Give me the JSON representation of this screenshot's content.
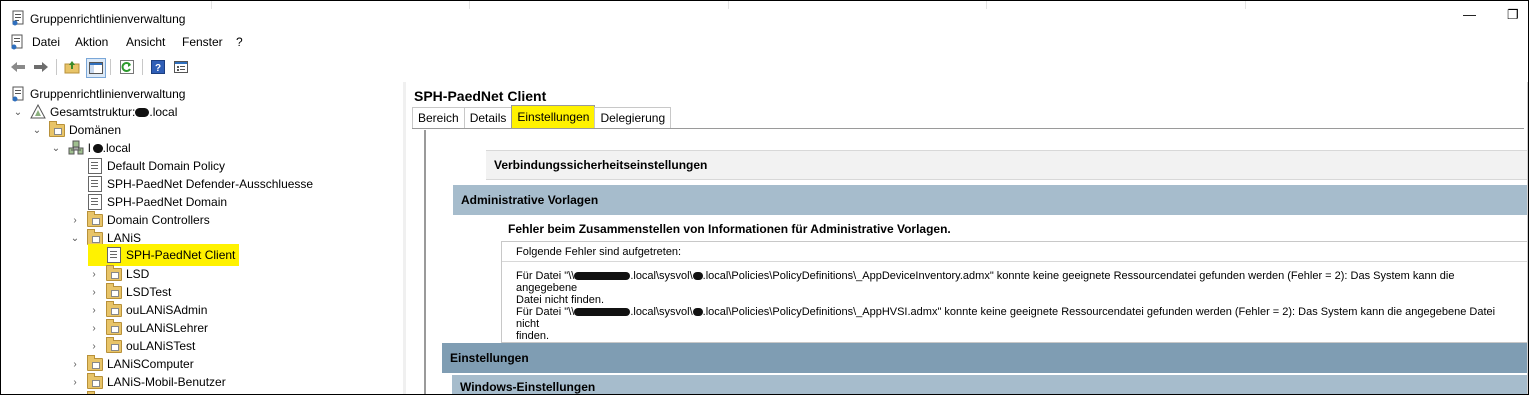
{
  "window": {
    "title": "Gruppenrichtlinienverwaltung",
    "minimize_glyph": "—",
    "restore_glyph": "❐"
  },
  "menu": {
    "items": [
      "Datei",
      "Aktion",
      "Ansicht",
      "Fenster",
      "?"
    ]
  },
  "toolbar": {
    "icons": [
      "back-arrow-icon",
      "forward-arrow-icon",
      "up-folder-icon",
      "show-hide-tree-icon",
      "refresh-icon",
      "help-icon",
      "properties-icon"
    ]
  },
  "tree": {
    "root": "Gruppenrichtlinienverwaltung",
    "forest_prefix": "Gesamtstruktur: ",
    "forest_suffix": ".local",
    "domains": "Domänen",
    "domain_suffix": ".local",
    "items": [
      "Default Domain Policy",
      "SPH-PaedNet Defender-Ausschluesse",
      "SPH-PaedNet Domain",
      "Domain Controllers",
      "LANiS",
      "SPH-PaedNet Client",
      "LSD",
      "LSDTest",
      "ouLANiSAdmin",
      "ouLANiSLehrer",
      "ouLANiSTest",
      "LANiSComputer",
      "LANiS-Mobil-Benutzer"
    ]
  },
  "details": {
    "title": "SPH-PaedNet Client",
    "tabs": [
      "Bereich",
      "Details",
      "Einstellungen",
      "Delegierung"
    ],
    "active_tab": "Einstellungen",
    "sections": {
      "verbindung": "Verbindungssicherheitseinstellungen",
      "admin": "Administrative Vorlagen",
      "error_title": "Fehler beim Zusammenstellen von Informationen für Administrative Vorlagen.",
      "error_header": "Folgende Fehler sind aufgetreten:",
      "err1_a": "Für Datei \"\\\\",
      "err1_b": ".local\\sysvol\\",
      "err1_c": ".local\\Policies\\PolicyDefinitions\\_AppDeviceInventory.admx\" konnte keine geeignete Ressourcendatei gefunden werden (Fehler = 2): Das System kann die angegebene",
      "err1_d": "Datei nicht finden.",
      "err2_a": "Für Datei \"\\\\",
      "err2_b": ".local\\sysvol\\",
      "err2_c": ".local\\Policies\\PolicyDefinitions\\_AppHVSI.admx\" konnte keine geeignete Ressourcendatei gefunden werden (Fehler = 2): Das System kann die angegebene Datei nicht",
      "err2_d": "finden.",
      "einstellungen": "Einstellungen",
      "windows": "Windows-Einstellungen"
    }
  },
  "colors": {
    "highlight": "#fff200",
    "section_admin": "#a6bccc",
    "section_settings": "#7f9db3"
  }
}
